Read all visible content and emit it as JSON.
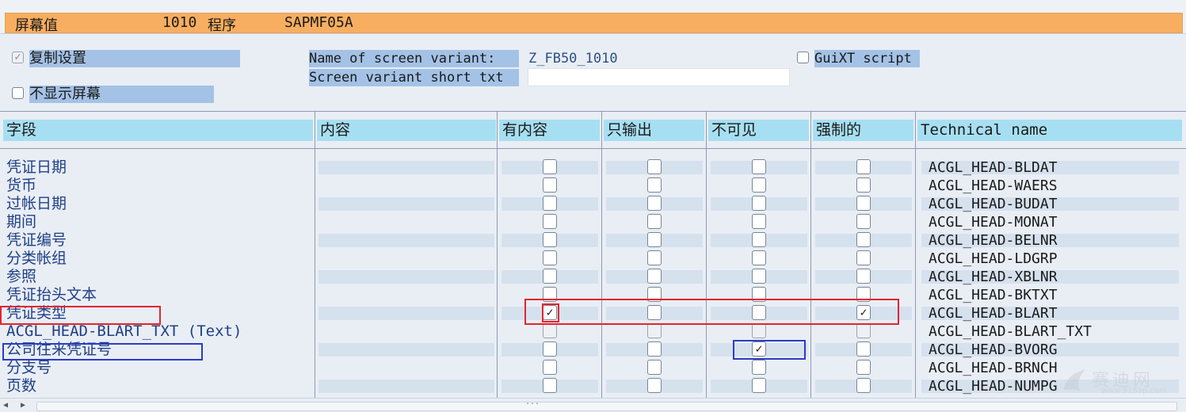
{
  "title_bar": {
    "label": "屏幕值",
    "screen_number": "1010",
    "program_label": "程序",
    "program_name": "SAPMF05A"
  },
  "settings": {
    "copy_settings": {
      "label": "复制设置",
      "checked": true
    },
    "hide_screen": {
      "label": "不显示屏幕",
      "checked": false
    },
    "variant_name_label": "Name of screen variant:",
    "variant_name_value": "Z_FB50_1010",
    "variant_short_text_label": "Screen variant short txt",
    "variant_short_text_value": "",
    "guixt": {
      "label": "GuiXT script",
      "checked": false
    }
  },
  "columns": [
    "字段",
    "内容",
    "有内容",
    "只输出",
    "不可见",
    "强制的",
    "Technical name"
  ],
  "rows": [
    {
      "field": "凭证日期",
      "tech": "ACGL_HEAD-BLDAT",
      "with_content": false,
      "output_only": false,
      "invisible": false,
      "required": false
    },
    {
      "field": "货币",
      "tech": "ACGL_HEAD-WAERS",
      "with_content": false,
      "output_only": false,
      "invisible": false,
      "required": false
    },
    {
      "field": "过帐日期",
      "tech": "ACGL_HEAD-BUDAT",
      "with_content": false,
      "output_only": false,
      "invisible": false,
      "required": false
    },
    {
      "field": "期间",
      "tech": "ACGL_HEAD-MONAT",
      "with_content": false,
      "output_only": false,
      "invisible": false,
      "required": false
    },
    {
      "field": "凭证编号",
      "tech": "ACGL_HEAD-BELNR",
      "with_content": false,
      "output_only": false,
      "invisible": false,
      "required": false
    },
    {
      "field": "分类帐组",
      "tech": "ACGL_HEAD-LDGRP",
      "with_content": false,
      "output_only": false,
      "invisible": false,
      "required": false
    },
    {
      "field": "参照",
      "tech": "ACGL_HEAD-XBLNR",
      "with_content": false,
      "output_only": false,
      "invisible": false,
      "required": false
    },
    {
      "field": "凭证抬头文本",
      "tech": "ACGL_HEAD-BKTXT",
      "with_content": false,
      "output_only": false,
      "invisible": false,
      "required": false
    },
    {
      "field": "凭证类型",
      "tech": "ACGL_HEAD-BLART",
      "with_content": true,
      "output_only": false,
      "invisible": false,
      "required": true
    },
    {
      "field": "ACGL_HEAD-BLART_TXT (Text)",
      "tech": "ACGL_HEAD-BLART_TXT",
      "with_content": false,
      "output_only": false,
      "invisible": false,
      "required": false,
      "disabled": true
    },
    {
      "field": "公司往来凭证号",
      "tech": "ACGL_HEAD-BVORG",
      "with_content": false,
      "output_only": false,
      "invisible": true,
      "required": false
    },
    {
      "field": "分支号",
      "tech": "ACGL_HEAD-BRNCH",
      "with_content": false,
      "output_only": false,
      "invisible": false,
      "required": false
    },
    {
      "field": "页数",
      "tech": "ACGL_HEAD-NUMPG",
      "with_content": false,
      "output_only": false,
      "invisible": false,
      "required": false
    }
  ],
  "watermark": {
    "text": "赛迪网",
    "url": "www.91Sap.com"
  },
  "scrollbar": {
    "center_mark": "..."
  },
  "colors": {
    "title_bar": "#f7ae60",
    "header": "#a7dff2",
    "label_blue": "#a4c2e6",
    "highlight_red": "#e32430",
    "highlight_blue": "#2b3cc8"
  }
}
